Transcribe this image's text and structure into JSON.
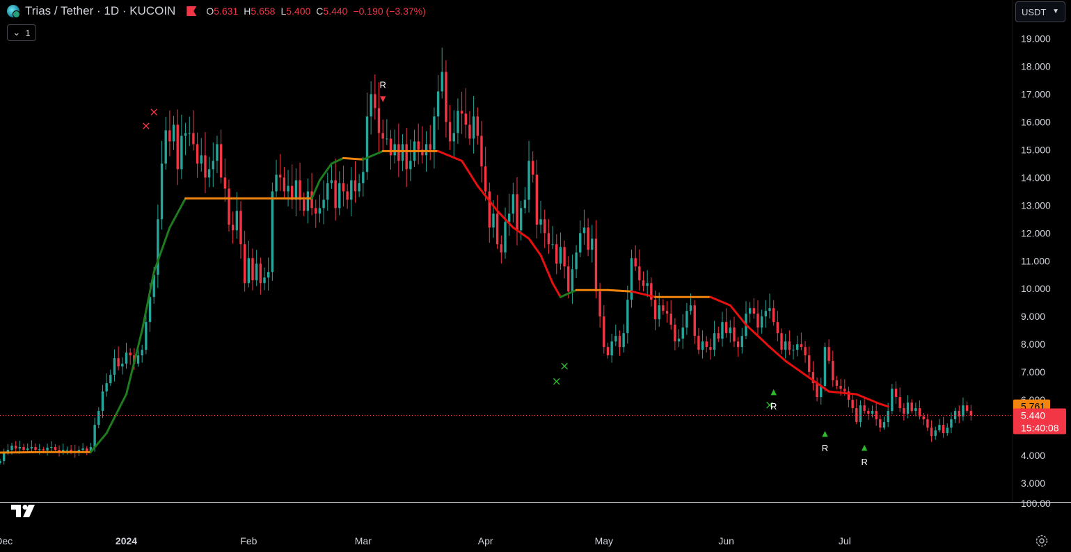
{
  "header": {
    "symbol": "Trias / Tether · 1D · KUCOIN",
    "open_label": "O",
    "open": "5.631",
    "high_label": "H",
    "high": "5.658",
    "low_label": "L",
    "low": "5.400",
    "close_label": "C",
    "close": "5.440",
    "change": "−0.190 (−3.37%)"
  },
  "indicator_button": {
    "count": "1",
    "icon": "chevron-down-icon"
  },
  "currency_selector": {
    "value": "USDT",
    "icon": "chevron-down-icon"
  },
  "price_tags": {
    "line_value": "5.761",
    "last_price": "5.440",
    "countdown": "15:40:08"
  },
  "colors": {
    "up": "#26a69a",
    "down": "#f23645",
    "line_bull": "#1e7b1e",
    "line_bear": "#e80f0f",
    "line_flat": "#f0840c",
    "bg": "#000000"
  },
  "chart_data": {
    "type": "candlestick",
    "title": "Trias / Tether · 1D · KUCOIN",
    "y_tick_labels": [
      "19.000",
      "18.000",
      "17.000",
      "16.000",
      "15.000",
      "14.000",
      "13.000",
      "12.000",
      "11.000",
      "10.000",
      "9.000",
      "8.000",
      "7.000",
      "6.000",
      "5.000",
      "4.000",
      "3.000"
    ],
    "ylim": [
      2.25,
      19.9
    ],
    "sub_pane_tick": "100.00",
    "x_tick_labels": [
      "Dec",
      "2024",
      "Feb",
      "Mar",
      "Apr",
      "May",
      "Jun",
      "Jul"
    ],
    "x_tick_dates": [
      "2023-12-01",
      "2024-01-01",
      "2024-02-01",
      "2024-03-01",
      "2024-04-01",
      "2024-05-01",
      "2024-06-01",
      "2024-07-01"
    ],
    "x_range": [
      "2023-11-30",
      "2024-08-12"
    ],
    "ohlc_series": {
      "start_date": "2023-11-30",
      "closes": [
        3.8,
        4.1,
        4.2,
        4.35,
        4.25,
        4.3,
        4.2,
        4.25,
        4.3,
        4.2,
        4.22,
        4.18,
        4.28,
        4.3,
        4.2,
        4.1,
        4.2,
        4.2,
        4.15,
        4.1,
        4.2,
        4.25,
        4.15,
        4.3,
        5.1,
        5.6,
        6.3,
        6.6,
        6.9,
        7.5,
        7.2,
        7.3,
        7.7,
        7.6,
        7.3,
        7.6,
        7.8,
        8.8,
        9.7,
        10.5,
        12.5,
        14.5,
        15.7,
        15.3,
        15.9,
        14.3,
        15.5,
        15.6,
        15.6,
        15.2,
        14.5,
        14.8,
        14.0,
        14.3,
        14.6,
        15.2,
        14.0,
        13.6,
        12.3,
        12.1,
        12.8,
        11.6,
        10.2,
        11.1,
        10.3,
        10.9,
        10.2,
        10.4,
        10.6,
        13.5,
        14.1,
        14.0,
        13.5,
        13.7,
        13.2,
        13.9,
        13.2,
        12.8,
        13.5,
        12.9,
        12.7,
        12.9,
        13.2,
        13.8,
        13.9,
        12.9,
        13.8,
        13.5,
        13.2,
        13.9,
        13.5,
        13.8,
        14.2,
        16.2,
        17.0,
        16.5,
        15.6,
        15.4,
        15.4,
        14.8,
        15.2,
        14.6,
        15.2,
        14.3,
        14.6,
        15.3,
        15.0,
        14.8,
        15.2,
        15.0,
        16.2,
        17.1,
        17.8,
        16.0,
        15.3,
        15.6,
        16.4,
        16.3,
        15.9,
        15.4,
        16.2,
        15.5,
        14.4,
        13.5,
        12.2,
        12.7,
        11.6,
        11.3,
        12.4,
        12.7,
        13.4,
        12.1,
        12.9,
        13.2,
        14.6,
        14.1,
        12.3,
        12.5,
        12.0,
        11.6,
        11.6,
        10.9,
        11.5,
        10.8,
        9.9,
        10.7,
        11.3,
        12.0,
        12.2,
        11.4,
        11.8,
        9.9,
        9.0,
        7.9,
        7.6,
        8.1,
        8.3,
        7.9,
        8.4,
        9.6,
        11.1,
        10.8,
        10.3,
        10.1,
        10.2,
        9.6,
        8.9,
        9.4,
        9.2,
        9.1,
        8.7,
        8.1,
        8.2,
        8.6,
        9.2,
        9.4,
        8.3,
        7.8,
        8.1,
        7.9,
        7.8,
        8.4,
        8.2,
        8.8,
        8.4,
        8.6,
        8.1,
        7.9,
        8.3,
        9.1,
        9.3,
        9.1,
        8.6,
        9.0,
        9.2,
        9.3,
        8.8,
        8.4,
        7.8,
        8.1,
        7.8,
        7.8,
        8.0,
        7.9,
        7.6,
        7.0,
        6.6,
        6.1,
        6.5,
        7.9,
        7.4,
        6.7,
        6.5,
        6.4,
        6.3,
        6.0,
        5.7,
        5.2,
        5.8,
        5.6,
        5.5,
        5.6,
        5.3,
        5.0,
        5.2,
        5.6,
        6.4,
        6.1,
        5.7,
        5.5,
        5.9,
        5.6,
        5.7,
        5.4,
        5.3,
        5.0,
        4.7,
        4.9,
        5.1,
        4.8,
        5.0,
        5.3,
        5.6,
        5.4,
        5.8,
        5.6,
        5.44
      ]
    },
    "line_series": {
      "name": "",
      "points": [
        [
          "2023-11-30",
          4.1
        ],
        [
          "2023-12-12",
          4.12
        ],
        [
          "2023-12-23",
          4.12
        ],
        [
          "2023-12-27",
          4.8
        ],
        [
          "2024-01-01",
          6.2
        ],
        [
          "2024-01-05",
          8.5
        ],
        [
          "2024-01-08",
          10.6
        ],
        [
          "2024-01-12",
          12.2
        ],
        [
          "2024-01-16",
          13.25
        ],
        [
          "2024-02-17",
          13.25
        ],
        [
          "2024-02-19",
          13.9
        ],
        [
          "2024-02-22",
          14.5
        ],
        [
          "2024-02-25",
          14.7
        ],
        [
          "2024-03-01",
          14.65
        ],
        [
          "2024-03-06",
          14.95
        ],
        [
          "2024-03-20",
          14.95
        ],
        [
          "2024-03-26",
          14.6
        ],
        [
          "2024-03-30",
          13.7
        ],
        [
          "2024-04-04",
          12.8
        ],
        [
          "2024-04-08",
          12.2
        ],
        [
          "2024-04-12",
          11.8
        ],
        [
          "2024-04-15",
          11.2
        ],
        [
          "2024-04-18",
          10.2
        ],
        [
          "2024-04-20",
          9.7
        ],
        [
          "2024-04-24",
          9.95
        ],
        [
          "2024-05-02",
          9.95
        ],
        [
          "2024-05-08",
          9.9
        ],
        [
          "2024-05-14",
          9.7
        ],
        [
          "2024-05-28",
          9.7
        ],
        [
          "2024-06-02",
          9.4
        ],
        [
          "2024-06-06",
          8.7
        ],
        [
          "2024-06-12",
          7.9
        ],
        [
          "2024-06-16",
          7.4
        ],
        [
          "2024-06-22",
          6.8
        ],
        [
          "2024-06-27",
          6.3
        ],
        [
          "2024-07-04",
          6.2
        ],
        [
          "2024-07-10",
          5.85
        ],
        [
          "2024-07-12",
          5.76
        ]
      ]
    },
    "markers": [
      {
        "date": "2024-01-08",
        "value": 16.35,
        "symbol": "×",
        "text": "",
        "color": "red"
      },
      {
        "date": "2024-01-06",
        "value": 15.85,
        "symbol": "×",
        "text": "",
        "color": "red"
      },
      {
        "date": "2024-03-06",
        "value": 16.8,
        "symbol": "▼",
        "text": "R",
        "color": "red"
      },
      {
        "date": "2024-04-19",
        "value": 6.65,
        "symbol": "×",
        "text": "",
        "color": "green"
      },
      {
        "date": "2024-04-21",
        "value": 7.2,
        "symbol": "×",
        "text": "",
        "color": "green"
      },
      {
        "date": "2024-06-12",
        "value": 5.8,
        "symbol": "×",
        "text": "",
        "color": "green"
      },
      {
        "date": "2024-06-13",
        "value": 6.2,
        "symbol": "▲",
        "text": "R",
        "color": "green"
      },
      {
        "date": "2024-06-26",
        "value": 4.7,
        "symbol": "▲",
        "text": "R",
        "color": "green"
      },
      {
        "date": "2024-07-06",
        "value": 4.2,
        "symbol": "▲",
        "text": "R",
        "color": "green"
      }
    ],
    "last_price_line": 5.44,
    "grid": false
  }
}
